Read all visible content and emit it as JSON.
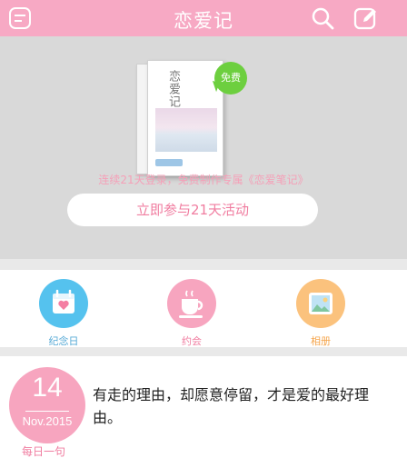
{
  "header": {
    "title": "恋爱记"
  },
  "banner": {
    "book_title": "恋爱记",
    "free_badge": "免费",
    "promo_text": "连续21天登录，免费制作专属《恋爱笔记》",
    "join_button": "立即参与21天活动"
  },
  "shortcuts": [
    {
      "label": "纪念日",
      "icon": "calendar-heart-icon",
      "color": "#55c2ee",
      "label_color": "#55a9d6"
    },
    {
      "label": "约会",
      "icon": "coffee-cup-icon",
      "color": "#f7a5bf",
      "label_color": "#f07da0"
    },
    {
      "label": "相册",
      "icon": "photo-album-icon",
      "color": "#fbc27d",
      "label_color": "#f5a44a"
    }
  ],
  "daily": {
    "day": "14",
    "month_year": "Nov.2015",
    "label": "每日一句",
    "quote": "有走的理由，却愿意停留，才是爱的最好理由。"
  },
  "colors": {
    "header": "#f7a9c4",
    "accent": "#f07da0",
    "free_badge": "#6dcf3f"
  }
}
